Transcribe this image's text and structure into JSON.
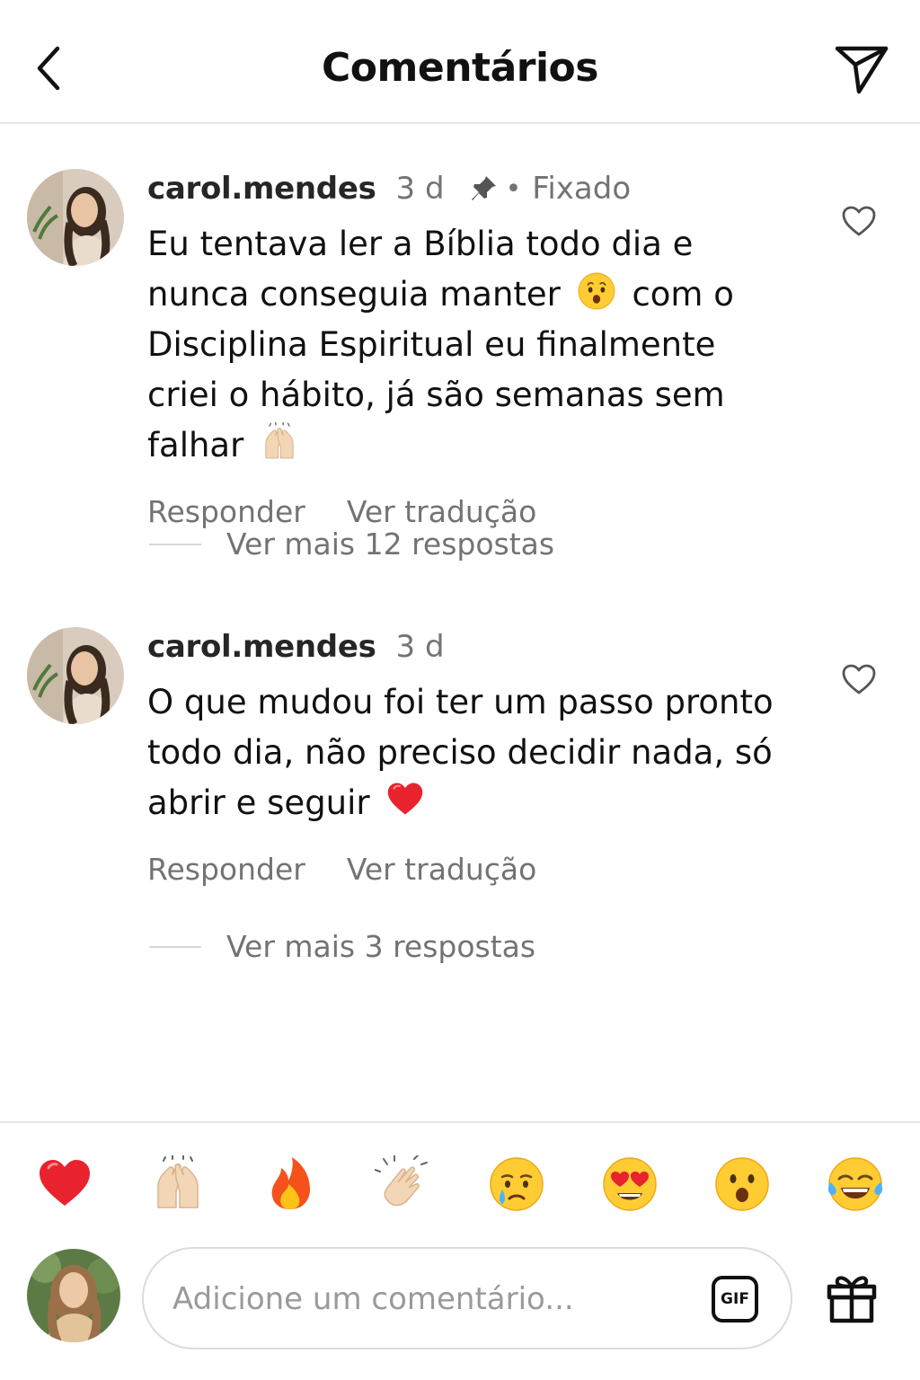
{
  "header": {
    "title": "Comentários",
    "back_icon": "chevron-left-icon",
    "send_icon": "paper-plane-icon"
  },
  "comments": [
    {
      "username": "carol.mendes",
      "time": "3 d",
      "pinned": true,
      "pin_separator": "•",
      "pinned_label": "Fixado",
      "text_part1": "Eu tentava ler a Bíblia todo dia e nunca conseguia manter",
      "text_part2": "com o Disciplina Espiritual eu finalmente criei o hábito, já são semanas sem falhar",
      "emoji1": "hushed-face",
      "emoji2": "raising-hands",
      "reply_label": "Responder",
      "translate_label": "Ver tradução",
      "more_replies": "Ver mais 12 respostas"
    },
    {
      "username": "carol.mendes",
      "time": "3 d",
      "pinned": false,
      "text_part1": "O que mudou foi ter um passo pronto todo dia, não preciso decidir nada, só abrir e seguir",
      "emoji1": "red-heart",
      "reply_label": "Responder",
      "translate_label": "Ver tradução",
      "more_replies": "Ver mais 3 respostas"
    }
  ],
  "reactions": [
    "red-heart",
    "raising-hands",
    "fire",
    "clapping-hands",
    "crying-face",
    "heart-eyes",
    "surprised-face",
    "tears-of-joy"
  ],
  "composer": {
    "placeholder": "Adicione um comentário...",
    "gif_label": "GIF",
    "gift_icon": "gift-icon"
  },
  "colors": {
    "heart_red": "#e8232d",
    "emoji_yellow": "#ffcc33",
    "muted_text": "#737373",
    "divider": "#e6e6e6"
  }
}
